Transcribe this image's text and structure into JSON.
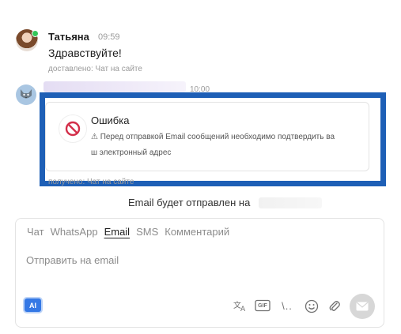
{
  "messages": [
    {
      "sender": "Татьяна",
      "time": "09:59",
      "text": "Здравствуйте!",
      "meta": "доставлено: Чат на сайте"
    }
  ],
  "system_message": {
    "time": "10:00",
    "avatar_icon": "wolf-avatar-icon"
  },
  "error": {
    "title": "Ошибка",
    "line1": "⚠ Перед отправкой Email сообщений необходимо подтвердить ва",
    "line2": "ш электронный адрес"
  },
  "system_meta": "получено: Чат на сайте",
  "email_notice": "Email будет отправлен на",
  "composer": {
    "tabs": [
      "Чат",
      "WhatsApp",
      "Email",
      "SMS",
      "Комментарий"
    ],
    "active_tab": "Email",
    "placeholder": "Отправить на email",
    "ai_label": "AI",
    "gif_label": "GIF",
    "template_label": "\\.."
  },
  "colors": {
    "highlight_frame": "#1e5fb6",
    "online": "#34c759",
    "ai_button": "#3478e5",
    "error_icon": "#d32f4a"
  }
}
